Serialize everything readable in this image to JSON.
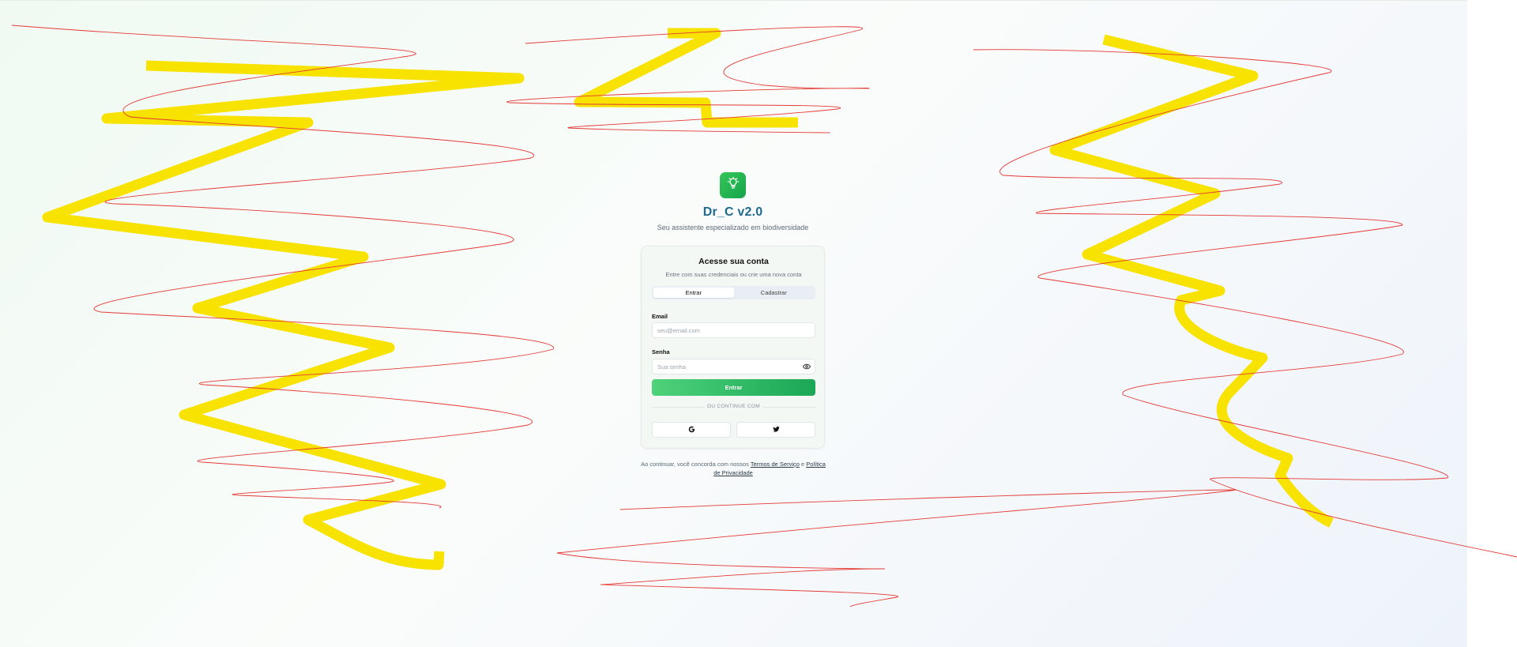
{
  "brand": {
    "title": "Dr_C v2.0",
    "subtitle": "Seu assistente especializado em biodiversidade",
    "logo_icon": "lightbulb-icon",
    "accent_color": "#1aa756",
    "title_color": "#1d6b8f"
  },
  "card": {
    "title": "Acesse sua conta",
    "description": "Entre com suas credenciais ou crie uma nova conta",
    "tabs": [
      {
        "label": "Entrar",
        "active": true
      },
      {
        "label": "Cadastrar",
        "active": false
      }
    ],
    "email": {
      "label": "Email",
      "placeholder": "seu@email.com",
      "value": ""
    },
    "password": {
      "label": "Senha",
      "placeholder": "Sua senha",
      "value": "",
      "toggle_icon": "eye-icon"
    },
    "submit_label": "Entrar",
    "divider_text": "OU CONTINUE COM",
    "social": [
      {
        "provider": "google",
        "icon": "google-icon"
      },
      {
        "provider": "twitter",
        "icon": "twitter-icon"
      }
    ]
  },
  "legal": {
    "prefix": "Ao continuar, você concorda com nossos ",
    "terms_label": "Termos de Serviço",
    "conjunction": " e ",
    "privacy_label": "Política de Privacidade"
  }
}
